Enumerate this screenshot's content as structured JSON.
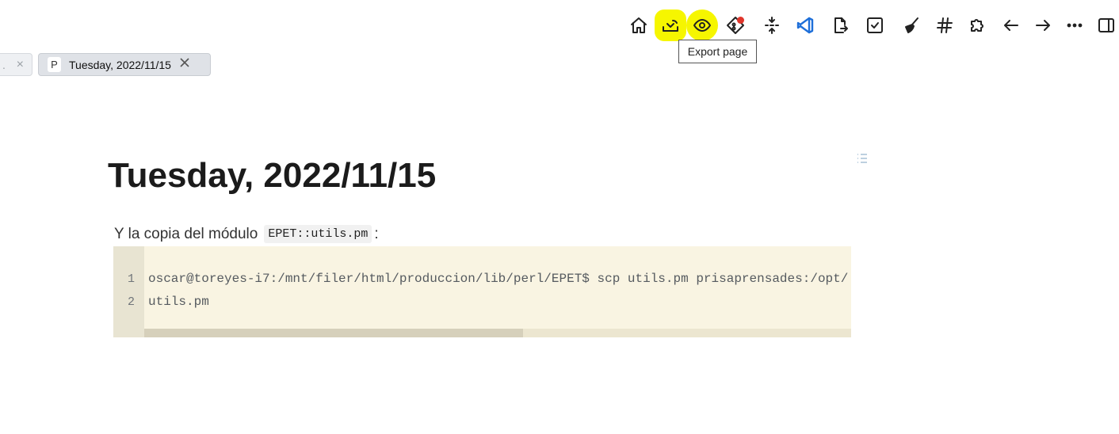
{
  "toolbar": {
    "buttons": [
      {
        "name": "home-icon",
        "label": "Home"
      },
      {
        "name": "export-icon",
        "label": "Export page"
      },
      {
        "name": "eye-icon",
        "label": "Preview"
      },
      {
        "name": "git-icon",
        "label": "Git"
      },
      {
        "name": "collapse-icon",
        "label": "Collapse"
      },
      {
        "name": "vscode-icon",
        "label": "VS Code"
      },
      {
        "name": "file-export-icon",
        "label": "File export"
      },
      {
        "name": "checkbox-icon",
        "label": "Tasks"
      },
      {
        "name": "broom-icon",
        "label": "Clean"
      },
      {
        "name": "hash-icon",
        "label": "Tags"
      },
      {
        "name": "puzzle-icon",
        "label": "Plugins"
      },
      {
        "name": "arrow-left-icon",
        "label": "Back"
      },
      {
        "name": "arrow-right-icon",
        "label": "Forward"
      },
      {
        "name": "more-icon",
        "label": "More"
      },
      {
        "name": "sidebar-toggle-icon",
        "label": "Toggle sidebar"
      }
    ],
    "accent_highlight": "#f6f600",
    "badge_color": "#e0352b"
  },
  "tooltip": {
    "text": "Export page"
  },
  "tabs": {
    "prev": {
      "close": "×"
    },
    "active": {
      "icon_letter": "P",
      "title": "Tuesday, 2022/11/15"
    }
  },
  "page": {
    "title": "Tuesday, 2022/11/15",
    "paragraph": {
      "text": "Y la copia del módulo",
      "code": "EPET::utils.pm",
      "suffix": ":"
    },
    "code_block": {
      "lines": [
        {
          "num": "1",
          "text": "oscar@toreyes-i7:/mnt/filer/html/produccion/lib/perl/EPET$ scp utils.pm prisaprensades:/opt/"
        },
        {
          "num": "2",
          "text": "utils.pm"
        }
      ],
      "background": "#f9f4e2"
    }
  }
}
